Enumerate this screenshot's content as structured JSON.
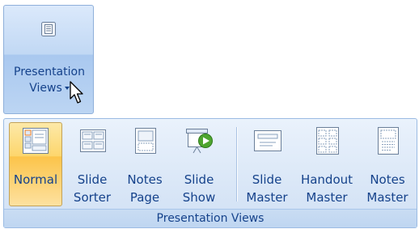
{
  "collapsed_group": {
    "label_line1": "Presentation",
    "label_line2": "Views"
  },
  "ribbon_group": {
    "caption": "Presentation Views",
    "buttons": [
      {
        "line1": "Normal",
        "line2": "",
        "icon": "normal-view-icon",
        "active": true
      },
      {
        "line1": "Slide",
        "line2": "Sorter",
        "icon": "slide-sorter-icon",
        "active": false
      },
      {
        "line1": "Notes",
        "line2": "Page",
        "icon": "notes-page-icon",
        "active": false
      },
      {
        "line1": "Slide",
        "line2": "Show",
        "icon": "slide-show-icon",
        "active": false
      },
      {
        "line1": "Slide",
        "line2": "Master",
        "icon": "slide-master-icon",
        "active": false
      },
      {
        "line1": "Handout",
        "line2": "Master",
        "icon": "handout-master-icon",
        "active": false
      },
      {
        "line1": "Notes",
        "line2": "Master",
        "icon": "notes-master-icon",
        "active": false
      }
    ]
  },
  "colors": {
    "text": "#15428b",
    "active_fill": "#fcc44a",
    "group_border": "#9bbbe3"
  }
}
